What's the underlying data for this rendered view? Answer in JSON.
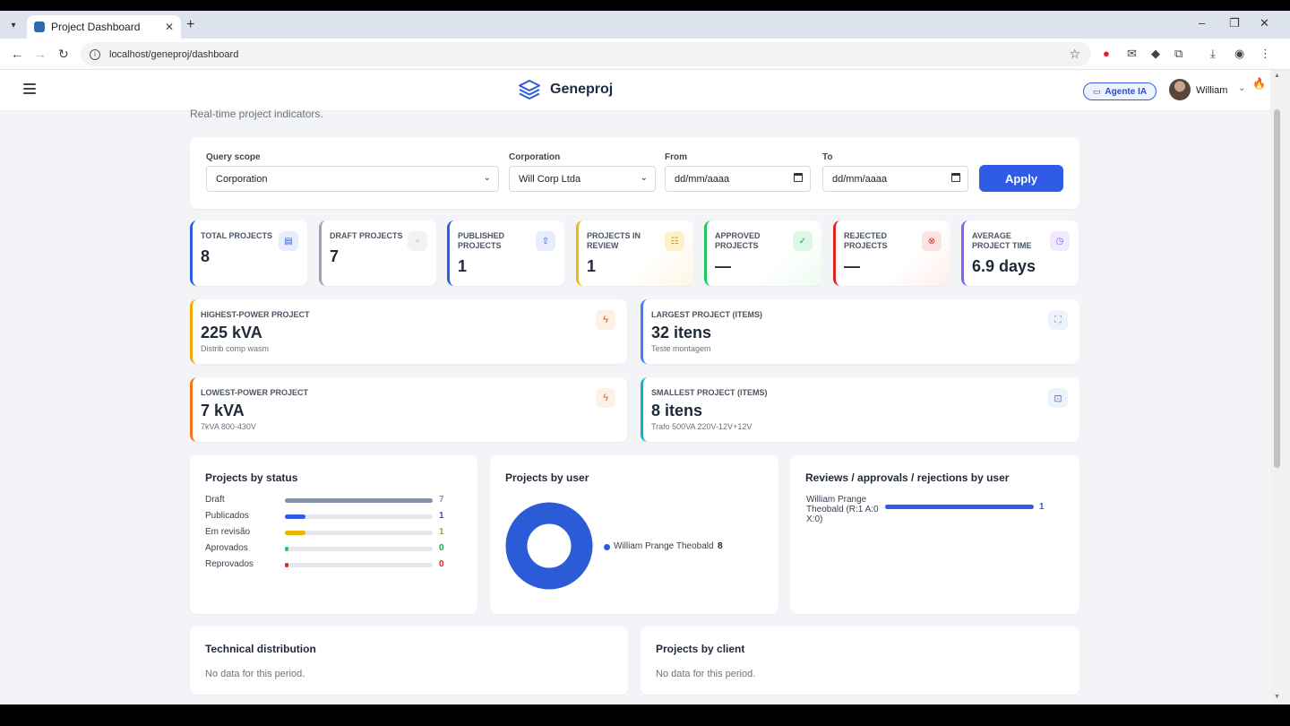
{
  "browser": {
    "tab_title": "Project Dashboard",
    "url": "localhost/geneproj/dashboard"
  },
  "header": {
    "app_name": "Geneproj",
    "agent_button": "Agente IA",
    "user_name": "William"
  },
  "page": {
    "subtitle": "Real-time project indicators."
  },
  "filters": {
    "scope_label": "Query scope",
    "scope_value": "Corporation",
    "corporation_label": "Corporation",
    "corporation_value": "Will Corp Ltda",
    "from_label": "From",
    "from_placeholder": "dd/mm/aaaa",
    "to_label": "To",
    "to_placeholder": "dd/mm/aaaa",
    "apply_label": "Apply"
  },
  "stats": [
    {
      "label": "TOTAL PROJECTS",
      "value": "8",
      "color": "#2f5be7"
    },
    {
      "label": "DRAFT PROJECTS",
      "value": "7",
      "color": "#9ca3af"
    },
    {
      "label": "PUBLISHED PROJECTS",
      "value": "1",
      "color": "#2f5be7"
    },
    {
      "label": "PROJECTS IN REVIEW",
      "value": "1",
      "color": "#f2b705"
    },
    {
      "label": "APPROVED PROJECTS",
      "value": "—",
      "color": "#22c55e"
    },
    {
      "label": "REJECTED PROJECTS",
      "value": "—",
      "color": "#dc2626"
    },
    {
      "label": "AVERAGE PROJECT TIME",
      "value": "6.9 days",
      "color": "#8b5cf6"
    }
  ],
  "highlights": [
    {
      "label": "HIGHEST-POWER PROJECT",
      "value": "225 kVA",
      "sub": "Distrib comp wasm",
      "color": "#f2a705"
    },
    {
      "label": "LARGEST PROJECT (ITEMS)",
      "value": "32 itens",
      "sub": "Teste montagem",
      "color": "#3b82f6"
    },
    {
      "label": "LOWEST-POWER PROJECT",
      "value": "7 kVA",
      "sub": "7kVA 800-430V",
      "color": "#f97316"
    },
    {
      "label": "SMALLEST PROJECT (ITEMS)",
      "value": "8 itens",
      "sub": "Trafo 500VA 220V-12V+12V",
      "color": "#06b6d4"
    }
  ],
  "status_panel": {
    "title": "Projects by status",
    "rows": [
      {
        "label": "Draft",
        "value": "7",
        "fraction": 1.0,
        "color": "#8592a8",
        "num_color": "#8592a8"
      },
      {
        "label": "Publicados",
        "value": "1",
        "fraction": 0.14,
        "color": "#2f5be7",
        "num_color": "#2f5be7"
      },
      {
        "label": "Em revisão",
        "value": "1",
        "fraction": 0.14,
        "color": "#e6b800",
        "num_color": "#c99700"
      },
      {
        "label": "Aprovados",
        "value": "0",
        "fraction": 0.02,
        "color": "#22c55e",
        "num_color": "#16a34a"
      },
      {
        "label": "Reprovados",
        "value": "0",
        "fraction": 0.02,
        "color": "#dc2626",
        "num_color": "#dc2626"
      }
    ]
  },
  "user_panel": {
    "title": "Projects by user",
    "legend_name": "William Prange Theobald",
    "legend_value": "8",
    "color": "#2c5bd8"
  },
  "reviews_panel": {
    "title": "Reviews / approvals / rejections by user",
    "user_label": "William Prange Theobald (R:1 A:0 X:0)",
    "value": "1",
    "fraction": 1.0
  },
  "tech_panel": {
    "title": "Technical distribution",
    "empty": "No data for this period."
  },
  "client_panel": {
    "title": "Projects by client",
    "empty": "No data for this period."
  }
}
